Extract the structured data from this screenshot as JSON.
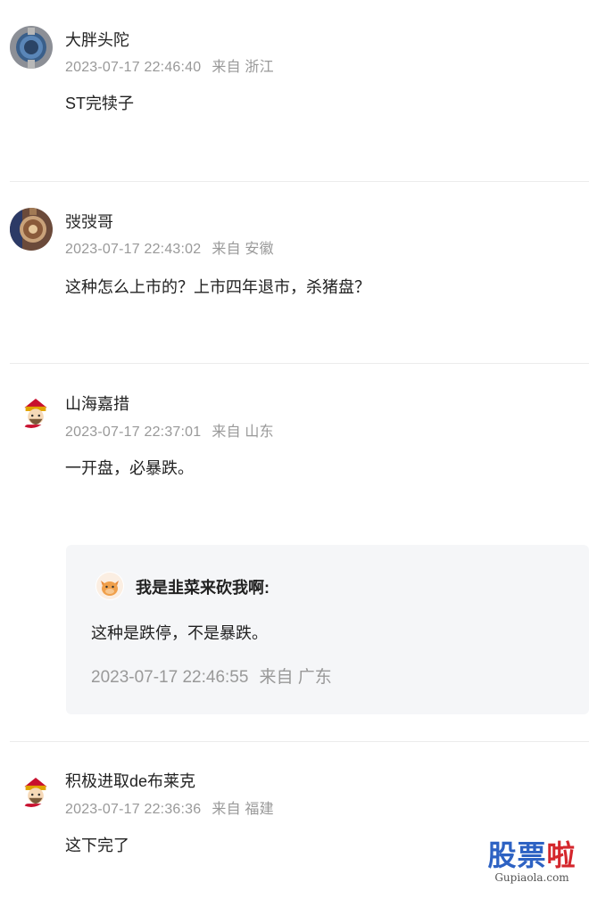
{
  "comments": [
    {
      "username": "大胖头陀",
      "timestamp": "2023-07-17 22:46:40",
      "location": "来自 浙江",
      "content": "ST完犊子",
      "avatar_icon": "watch-avatar-icon"
    },
    {
      "username": "弢弢哥",
      "timestamp": "2023-07-17 22:43:02",
      "location": "来自 安徽",
      "content": "这种怎么上市的？上市四年退市，杀猪盘？",
      "avatar_icon": "watch-avatar-icon"
    },
    {
      "username": "山海嘉措",
      "timestamp": "2023-07-17 22:37:01",
      "location": "来自 山东",
      "content": "一开盘，必暴跌。",
      "avatar_icon": "fortune-god-avatar-icon",
      "reply": {
        "username": "我是韭菜来砍我啊:",
        "content": "这种是跌停，不是暴跌。",
        "timestamp": "2023-07-17 22:46:55",
        "location": "来自 广东",
        "avatar_icon": "cow-avatar-icon"
      }
    },
    {
      "username": "积极进取de布莱克",
      "timestamp": "2023-07-17 22:36:36",
      "location": "来自 福建",
      "content": "这下完了",
      "avatar_icon": "fortune-god-avatar-icon"
    }
  ],
  "watermark": {
    "main_a": "股票",
    "main_b": "啦",
    "sub": "Gupiaola.com"
  },
  "colors": {
    "meta_gray": "#999999",
    "reply_bg": "#f5f6f8",
    "watermark_blue": "#2d62c3",
    "watermark_red": "#d4262c"
  }
}
